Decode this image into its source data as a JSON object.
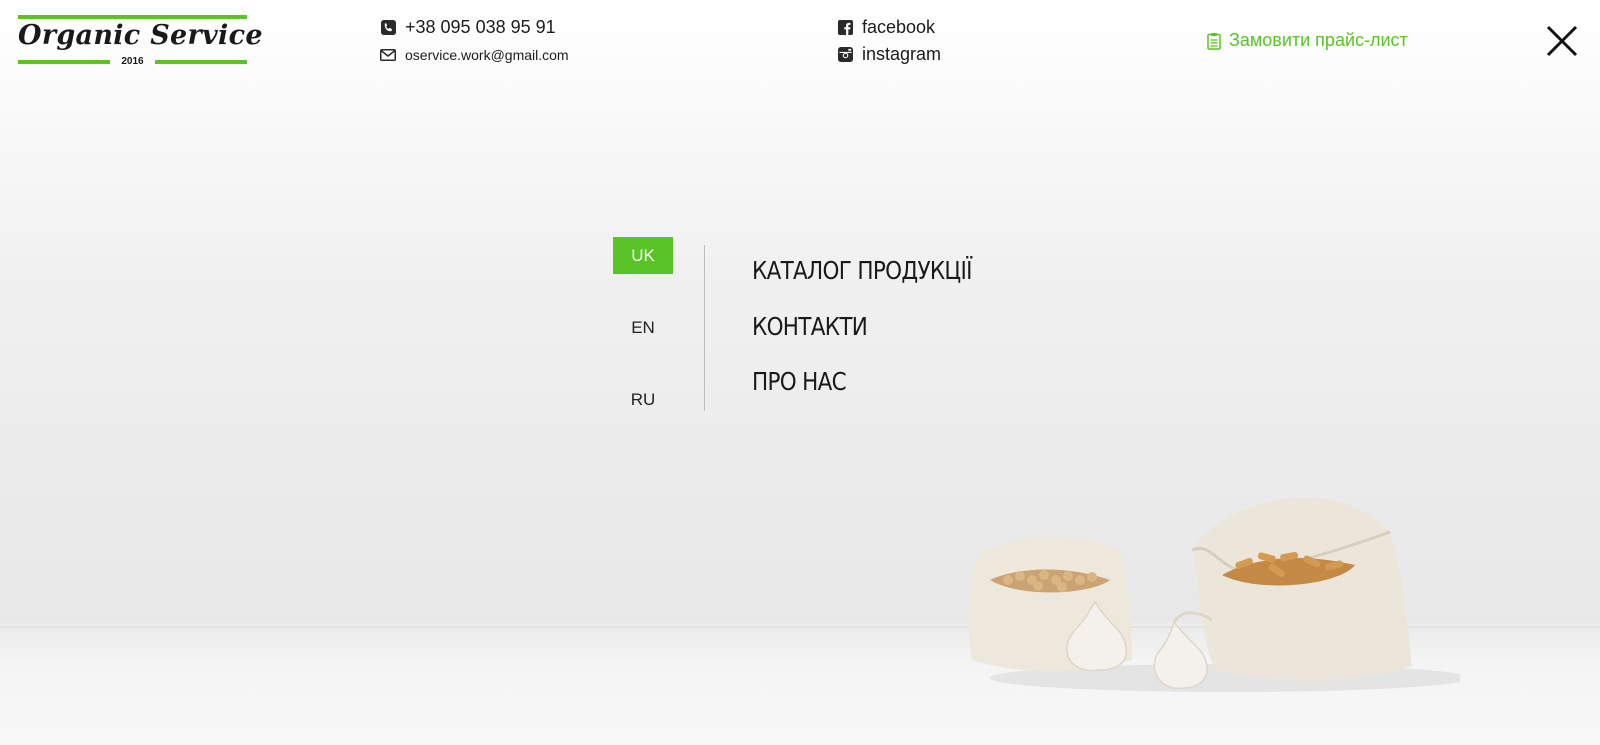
{
  "header": {
    "logo": {
      "name": "Organic Service",
      "year": "2016"
    },
    "contacts": {
      "phone": "+38 095 038 95 91",
      "email": "oservice.work@gmail.com",
      "facebook": "facebook",
      "instagram": "instagram"
    },
    "price_list_label": "Замовити прайс-лист",
    "accent_color": "#5ac327"
  },
  "languages": [
    {
      "code": "UK",
      "active": true
    },
    {
      "code": "EN",
      "active": false
    },
    {
      "code": "RU",
      "active": false
    }
  ],
  "menu": [
    {
      "label": "КАТАЛОГ ПРОДУКЦІЇ"
    },
    {
      "label": "КОНТАКТИ"
    },
    {
      "label": "ПРО НАС"
    }
  ],
  "icons": [
    "phone-icon",
    "mail-icon",
    "facebook-icon",
    "instagram-icon",
    "clipboard-icon",
    "close-icon"
  ]
}
